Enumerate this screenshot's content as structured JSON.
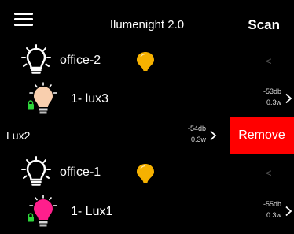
{
  "nav": {
    "menu_icon": "hamburger-menu-icon",
    "title": "Ilumenight 2.0",
    "scan_label": "Scan"
  },
  "group1": {
    "name": "office-2",
    "bulb_icon": "lightbulb-outline-icon",
    "brightness": 0.26,
    "chevron": "<",
    "chevron_icon": "chevron-left-icon"
  },
  "device1": {
    "name": "1- lux3",
    "bulb_color": "#f9cfae",
    "lock_icon": "lock-icon",
    "signal": "-53db",
    "power": "0.3w",
    "chevron_icon": "chevron-right-icon"
  },
  "device_swiped": {
    "name": "Lux2",
    "signal": "-54db",
    "power": "0.3w",
    "chevron_icon": "chevron-right-icon",
    "remove_label": "Remove"
  },
  "group2": {
    "name": "office-1",
    "bulb_icon": "lightbulb-outline-icon",
    "brightness": 0.26,
    "chevron": "<",
    "chevron_icon": "chevron-left-icon"
  },
  "device2": {
    "name": "1- Lux1",
    "bulb_color": "#ff1f8c",
    "lock_icon": "lock-icon",
    "signal": "-55db",
    "power": "0.3w",
    "chevron_icon": "chevron-right-icon"
  },
  "colors": {
    "background": "#000000",
    "slider_thumb": "#f6b100",
    "remove_button": "#ff0000",
    "lock": "#2dd63a"
  }
}
